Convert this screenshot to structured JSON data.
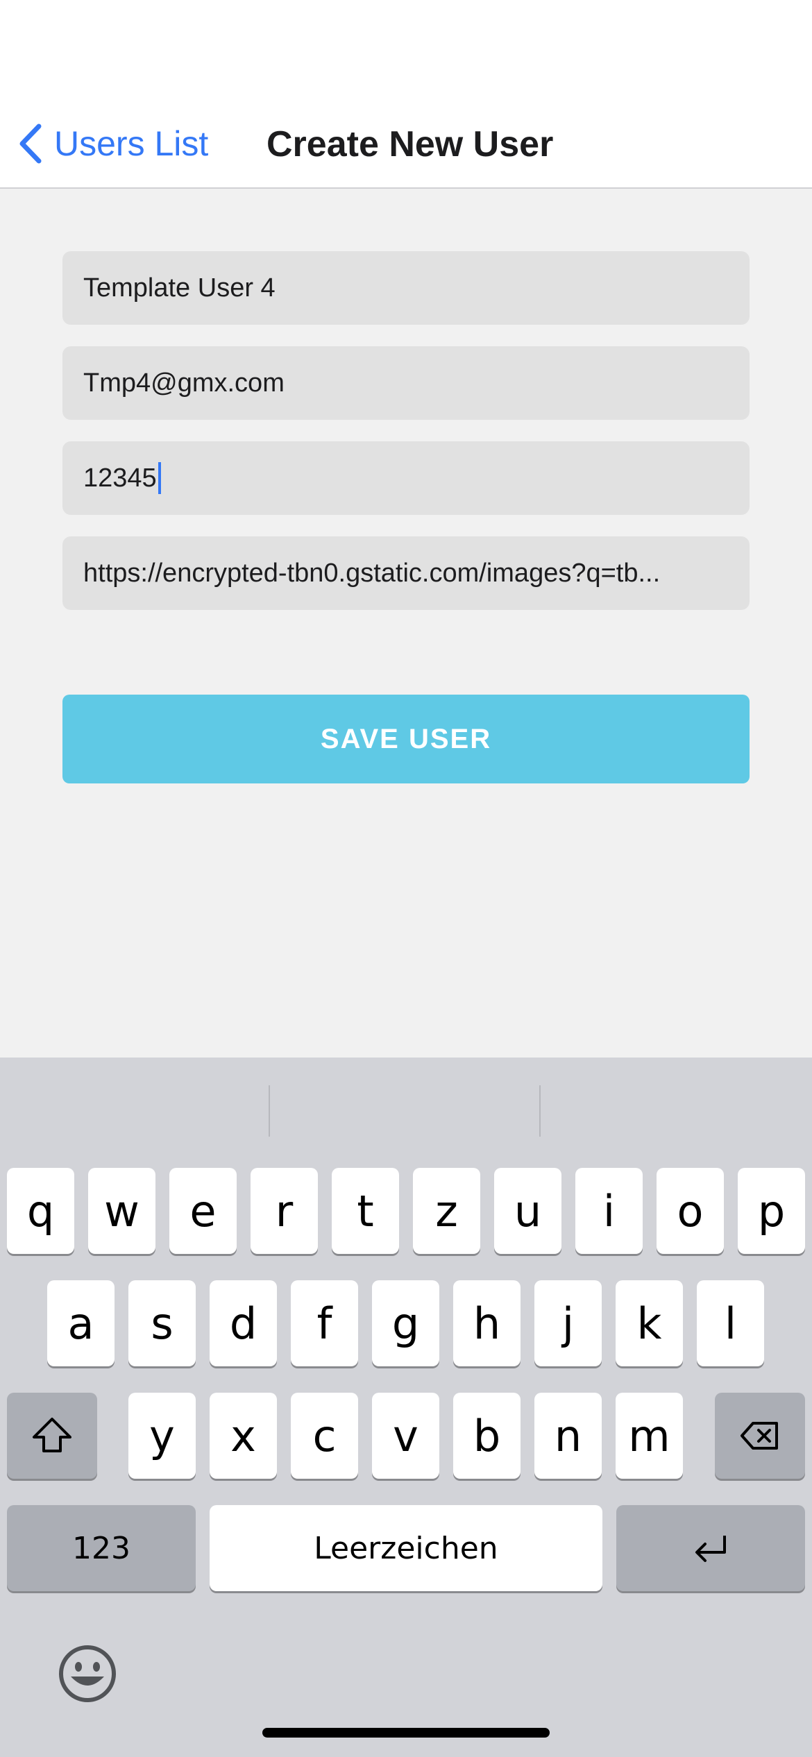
{
  "nav": {
    "back_label": "Users List",
    "title": "Create New User"
  },
  "form": {
    "name": "Template User 4",
    "email": "Tmp4@gmx.com",
    "password": "12345",
    "image_url": "https://encrypted-tbn0.gstatic.com/images?q=tb...",
    "save_label": "SAVE USER",
    "save_color": "#5fc9e5"
  },
  "keyboard": {
    "row1": [
      "q",
      "w",
      "e",
      "r",
      "t",
      "z",
      "u",
      "i",
      "o",
      "p"
    ],
    "row2": [
      "a",
      "s",
      "d",
      "f",
      "g",
      "h",
      "j",
      "k",
      "l"
    ],
    "row3": [
      "y",
      "x",
      "c",
      "v",
      "b",
      "n",
      "m"
    ],
    "numbers_label": "123",
    "space_label": "Leerzeichen",
    "icons": [
      "shift-icon",
      "delete-icon",
      "return-icon",
      "emoji-icon"
    ]
  },
  "colors": {
    "accent": "#3478f6",
    "keyboard_bg": "#d2d3d8"
  }
}
